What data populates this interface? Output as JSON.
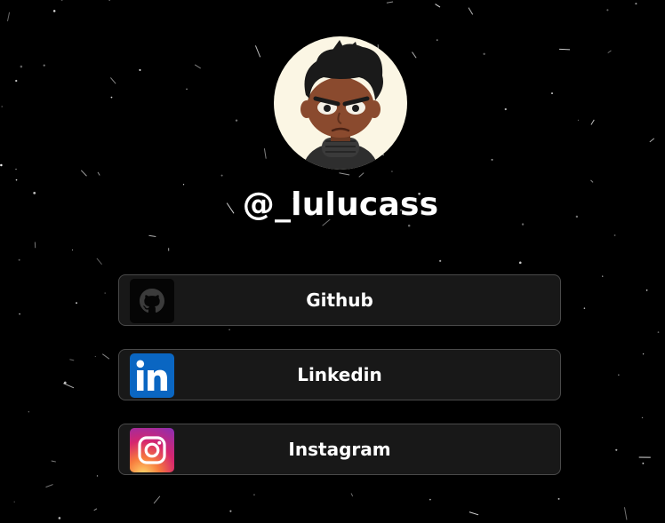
{
  "profile": {
    "username": "@_lulucass"
  },
  "links": [
    {
      "label": "Github",
      "icon": "github-icon"
    },
    {
      "label": "Linkedin",
      "icon": "linkedin-icon"
    },
    {
      "label": "Instagram",
      "icon": "instagram-icon"
    }
  ],
  "colors": {
    "background": "#000000",
    "button_bg": "#181818",
    "button_border": "#4a4a4a",
    "linkedin_blue": "#0a66c2",
    "avatar_bg": "#fbf6e4"
  }
}
